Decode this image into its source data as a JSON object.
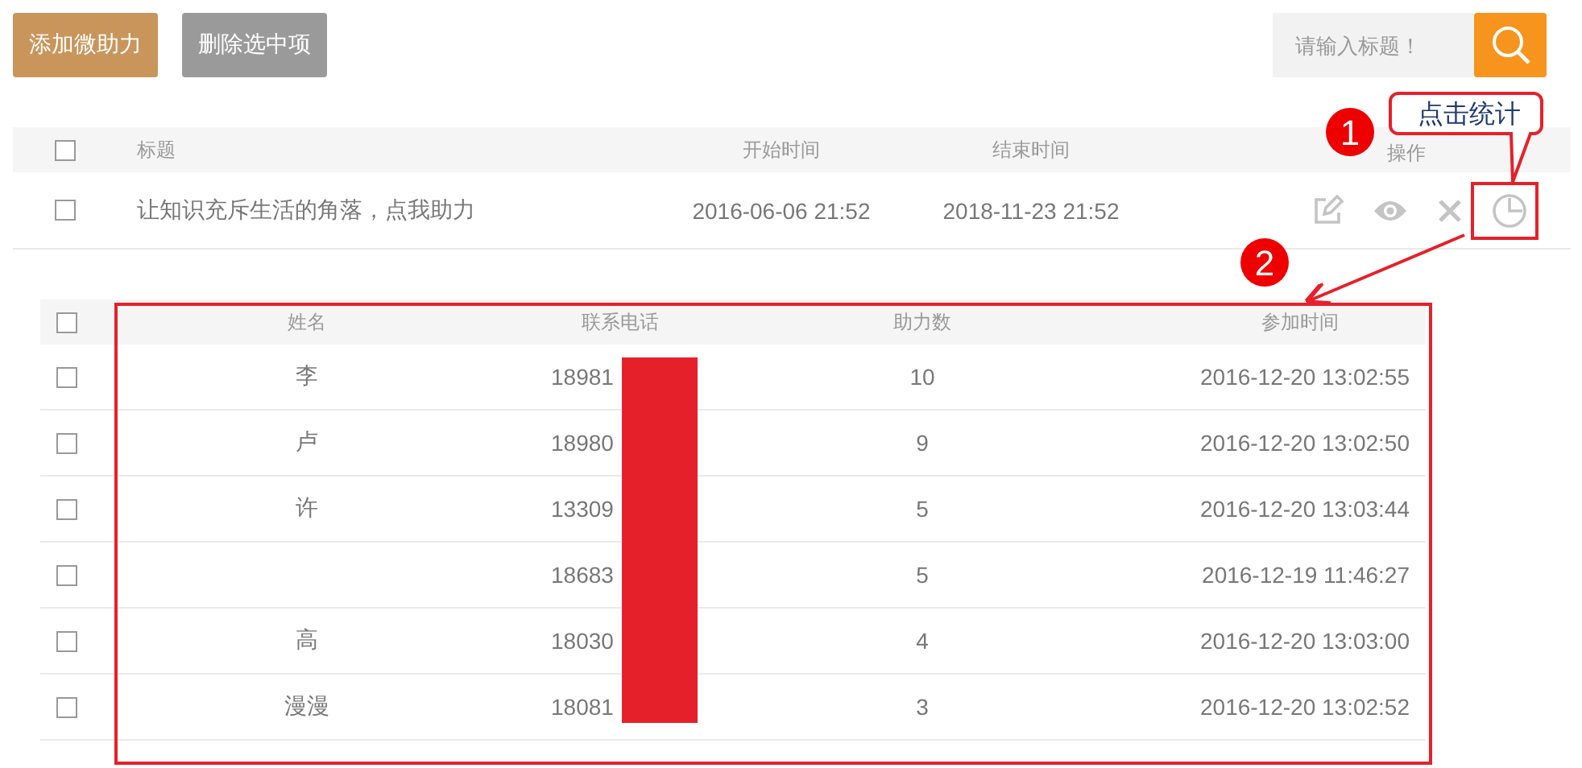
{
  "toolbar": {
    "buttons": [
      {
        "label": "添加微助力",
        "kind": "primary"
      },
      {
        "label": "删除选中项",
        "kind": "secondary"
      }
    ],
    "search": {
      "placeholder": "请输入标题！"
    }
  },
  "campaign_table": {
    "select_all_checked": false,
    "columns": [
      "标题",
      "开始时间",
      "结束时间",
      "操作"
    ],
    "rows": [
      {
        "checked": false,
        "title": "让知识充斥生活的角落，点我助力",
        "start": "2016-06-06 21:52",
        "end": "2018-11-23 21:52"
      }
    ]
  },
  "participants_table": {
    "select_all_checked": false,
    "columns": [
      "姓名",
      "联系电话",
      "助力数",
      "参加时间"
    ],
    "rows": [
      {
        "checked": false,
        "name": "李",
        "phone": "18981",
        "count": "10",
        "joined": "2016-12-20 13:02:55"
      },
      {
        "checked": false,
        "name": "卢",
        "phone": "18980",
        "count": "9",
        "joined": "2016-12-20 13:02:50"
      },
      {
        "checked": false,
        "name": "许",
        "phone": "13309",
        "count": "5",
        "joined": "2016-12-20 13:03:44"
      },
      {
        "checked": false,
        "phone": "18683",
        "count": "5",
        "joined": "2016-12-19 11:46:27"
      },
      {
        "checked": false,
        "name": "高",
        "phone": "18030",
        "count": "4",
        "joined": "2016-12-20 13:03:00"
      },
      {
        "checked": false,
        "name": "漫漫",
        "phone": "18081",
        "count": "3",
        "joined": "2016-12-20 13:02:52"
      }
    ]
  },
  "annotations": {
    "markers": [
      "1",
      "2"
    ],
    "callout": "点击统计"
  }
}
